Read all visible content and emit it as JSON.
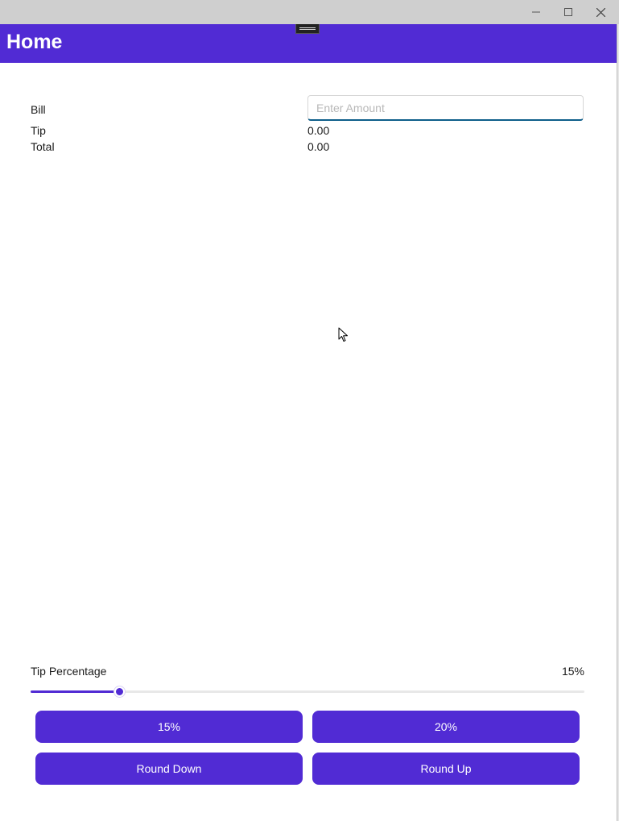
{
  "window": {
    "controls": {
      "minimize_icon": "minimize-icon",
      "maximize_icon": "maximize-icon",
      "close_icon": "close-icon"
    }
  },
  "header": {
    "title": "Home",
    "background": "#512bd4"
  },
  "form": {
    "bill_label": "Bill",
    "bill_value": "",
    "bill_placeholder": "Enter Amount",
    "tip_label": "Tip",
    "tip_value": "0.00",
    "total_label": "Total",
    "total_value": "0.00"
  },
  "tip_percentage": {
    "label": "Tip Percentage",
    "value_text": "15%",
    "slider_value": 0.16
  },
  "buttons": {
    "preset_15": "15%",
    "preset_20": "20%",
    "round_down": "Round Down",
    "round_up": "Round Up"
  },
  "colors": {
    "accent": "#512bd4",
    "input_underline": "#0e5e8a"
  }
}
